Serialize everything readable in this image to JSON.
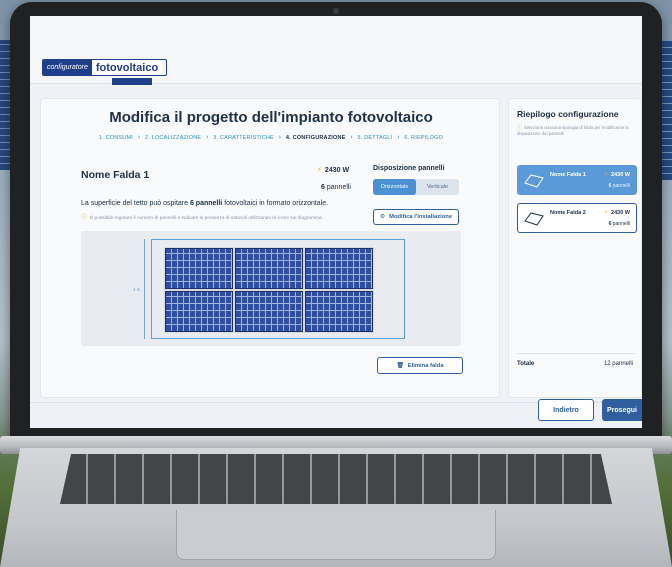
{
  "header": {
    "logo_left": "configuratore",
    "logo_right": "fotovoltaico"
  },
  "main": {
    "title": "Modifica il progetto dell'impianto fotovoltaico",
    "steps": [
      {
        "label": "1. CONSUMI",
        "current": false
      },
      {
        "label": "2. LOCALIZZAZIONE",
        "current": false
      },
      {
        "label": "3. CARATTERISTICHE",
        "current": false
      },
      {
        "label": "4. CONFIGURAZIONE",
        "current": true
      },
      {
        "label": "5. DETTAGLI",
        "current": false
      },
      {
        "label": "6. RIEPILOGO",
        "current": false
      }
    ],
    "falda_name": "Nome Falda 1",
    "power": "2430 W",
    "panels_count": "6",
    "panels_word": "pannelli",
    "disposition_label": "Disposizione pannelli",
    "disposition_options": [
      "Orizzontale",
      "Verticale"
    ],
    "disposition_selected": "Orizzontale",
    "surface_text_pre": "La superficie del tetto può ospitare ",
    "surface_text_bold": "6 pannelli",
    "surface_text_post": " fotovoltaici in formato orizzontale.",
    "hint": "È possibile regolare il numero di pannelli e indicare la presenza di ostacoli utilizzando le icone sul diagramma.",
    "modify_button": "Modifica l'installazione",
    "dimension_label": "4 m",
    "delete_button": "Elimina falda"
  },
  "sidebar": {
    "title": "Riepilogo configurazione",
    "hint": "Seleziona ciascuna tipologia di falda per modificarne la disposizione dei pannelli",
    "faldas": [
      {
        "name": "Nome Falda 1",
        "power": "2430 W",
        "count": "6",
        "unit": "pannelli",
        "selected": true
      },
      {
        "name": "Nome Falda 2",
        "power": "2430 W",
        "count": "6",
        "unit": "pannelli",
        "selected": false
      }
    ],
    "total_label": "Totale",
    "total_value": "12 pannelli"
  },
  "footer": {
    "back_button": "Indietro",
    "next_button": "Prosegui"
  },
  "colors": {
    "primary": "#2f5f9e",
    "accent_blue": "#4a90d2",
    "bolt": "#f2b019",
    "panel": "#2f4ea0"
  }
}
